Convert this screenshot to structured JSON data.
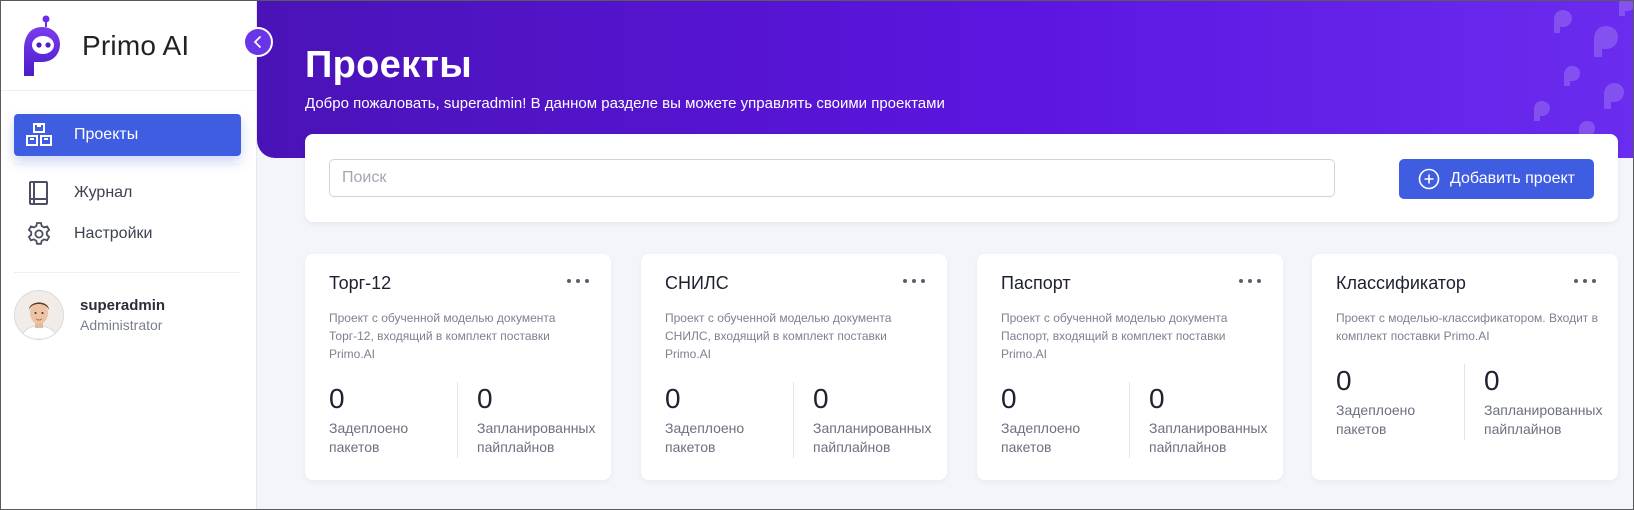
{
  "app": {
    "brand_name": "Primo AI",
    "accent": "#3f5de0",
    "header_color": "#5c15e0"
  },
  "sidebar": {
    "items": [
      {
        "label": "Проекты",
        "icon": "projects-icon",
        "active": true
      },
      {
        "label": "Журнал",
        "icon": "journal-icon",
        "active": false
      },
      {
        "label": "Настройки",
        "icon": "gear-icon",
        "active": false
      }
    ],
    "user": {
      "name": "superadmin",
      "role": "Administrator"
    }
  },
  "header": {
    "title": "Проекты",
    "subtitle": "Добро пожаловать, superadmin! В данном разделе вы можете управлять своими проектами"
  },
  "search": {
    "placeholder": "Поиск",
    "value": ""
  },
  "toolbar": {
    "add_label": "Добавить проект"
  },
  "projects": [
    {
      "title": "Торг-12",
      "description": "Проект с обученной моделью документа Торг-12, входящий в комплект поставки Primo.AI",
      "deployed_value": "0",
      "deployed_label": "Задеплоено пакетов",
      "planned_value": "0",
      "planned_label": "Запланированных пайплайнов"
    },
    {
      "title": "СНИЛС",
      "description": "Проект с обученной моделью документа СНИЛС, входящий в комплект поставки Primo.AI",
      "deployed_value": "0",
      "deployed_label": "Задеплоено пакетов",
      "planned_value": "0",
      "planned_label": "Запланированных пайплайнов"
    },
    {
      "title": "Паспорт",
      "description": "Проект с обученной моделью документа Паспорт, входящий в комплект поставки Primo.AI",
      "deployed_value": "0",
      "deployed_label": "Задеплоено пакетов",
      "planned_value": "0",
      "planned_label": "Запланированных пайплайнов"
    },
    {
      "title": "Классификатор",
      "description": "Проект с моделью-классификатором. Входит в комплект поставки Primo.AI",
      "deployed_value": "0",
      "deployed_label": "Задеплоено пакетов",
      "planned_value": "0",
      "planned_label": "Запланированных пайплайнов"
    }
  ]
}
